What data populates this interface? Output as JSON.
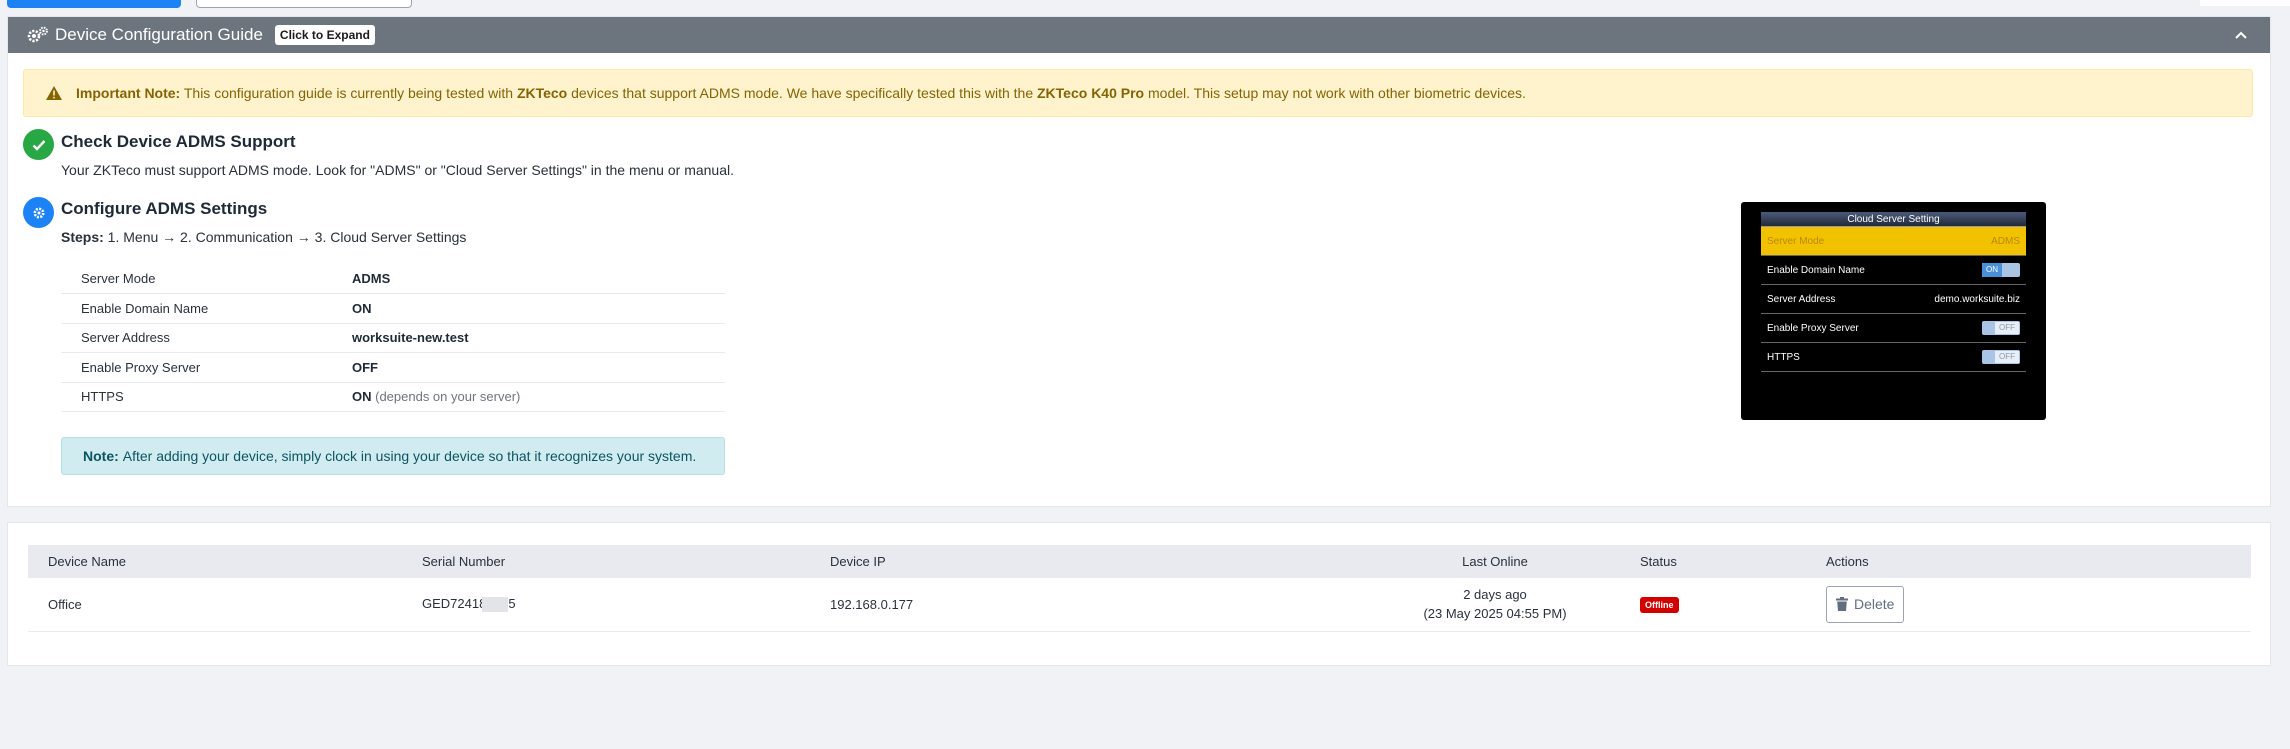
{
  "guide": {
    "title": "Device Configuration Guide",
    "expand_badge": "Click to Expand",
    "alert": {
      "label": "Important Note:",
      "text1": " This configuration guide is currently being tested with ",
      "brand": "ZKTeco",
      "text2": " devices that support ADMS mode. We have specifically tested this with the ",
      "model": "ZKTeco K40 Pro",
      "text3": " model. This setup may not work with other biometric devices."
    },
    "step1": {
      "title": "Check Device ADMS Support",
      "desc": "Your ZKTeco must support ADMS mode. Look for \"ADMS\" or \"Cloud Server Settings\" in the menu or manual."
    },
    "step2": {
      "title": "Configure ADMS Settings",
      "steps_label": "Steps:",
      "steps_text": " 1. Menu → 2. Communication → 3. Cloud Server Settings"
    },
    "settings": [
      {
        "key": "Server Mode",
        "value": "ADMS",
        "note": ""
      },
      {
        "key": "Enable Domain Name",
        "value": "ON",
        "note": ""
      },
      {
        "key": "Server Address",
        "value": "worksuite-new.test",
        "note": ""
      },
      {
        "key": "Enable Proxy Server",
        "value": "OFF",
        "note": ""
      },
      {
        "key": "HTTPS",
        "value": "ON",
        "note": " (depends on your server)"
      }
    ],
    "note": {
      "label": "Note:",
      "text": "After adding your device, simply clock in using your device so that it recognizes your system."
    },
    "device_screen": {
      "title": "Cloud Server Setting",
      "rows": [
        {
          "label": "Server Mode",
          "value": "ADMS"
        },
        {
          "label": "Enable Domain Name",
          "value": "ON"
        },
        {
          "label": "Server Address",
          "value": "demo.worksuite.biz"
        },
        {
          "label": "Enable Proxy Server",
          "value": "OFF"
        },
        {
          "label": "HTTPS",
          "value": "OFF"
        }
      ]
    }
  },
  "devices": {
    "headers": [
      "Device Name",
      "Serial Number",
      "Device IP",
      "Last Online",
      "Status",
      "Actions"
    ],
    "rows": [
      {
        "name": "Office",
        "serial_prefix": "GED72418",
        "serial_suffix": "5",
        "ip": "192.168.0.177",
        "last_online_relative": "2 days ago",
        "last_online_abs": "(23 May 2025 04:55 PM)",
        "status": "Offline",
        "action": "Delete"
      }
    ]
  },
  "colors": {
    "header_bg": "#6c757d",
    "primary": "#1d82f5",
    "success": "#28a745",
    "danger": "#d30000",
    "warning_bg": "#fff3cd",
    "info_bg": "#d1ecf1"
  }
}
